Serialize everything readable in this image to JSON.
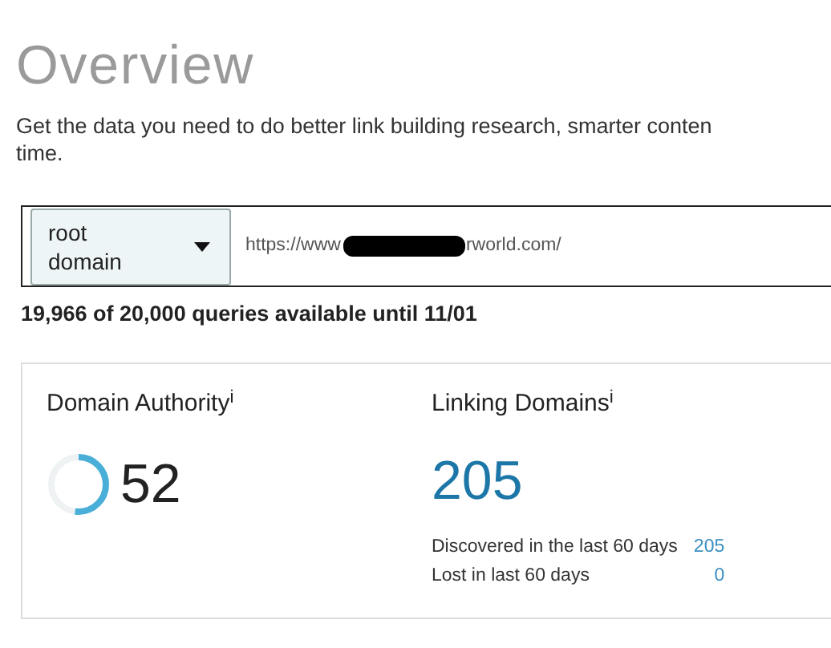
{
  "title": "Overview",
  "description_lines": [
    "Get the data you need to do better link building research, smarter conten",
    "time."
  ],
  "search": {
    "scope_select": "root domain",
    "url_start": "https://www",
    "redacted": true,
    "url_end": "rworld.com/"
  },
  "quota": "19,966 of 20,000 queries available until 11/01",
  "metrics": {
    "domain_authority": {
      "label": "Domain Authority$^{i}$",
      "value": "52"
    },
    "linking_domains": {
      "label": "Linking Domains$^{i}$",
      "value": "205",
      "rows": [
        {
          "label": "Discovered in the last 60 days",
          "value": "205"
        },
        {
          "label": "Lost in last 60 days",
          "value": "0"
        }
      ]
    }
  }
}
